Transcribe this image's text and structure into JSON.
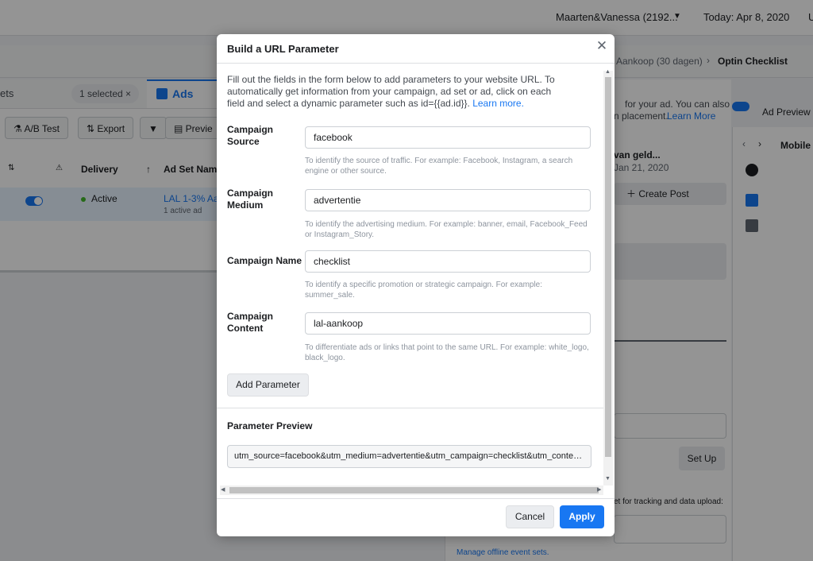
{
  "background": {
    "account": "Maarten&Vanessa (2192...",
    "date": "Today: Apr 8, 2020",
    "user_initial": "U",
    "breadcrumb": {
      "item1": "Aankoop (30 dagen)",
      "item2": "Optin Checklist"
    },
    "tabs": {
      "ad_sets_partial": "ets",
      "selected_pill": "1 selected",
      "ads": "Ads"
    },
    "toolbar": {
      "ab_test": "A/B Test",
      "export": "Export",
      "preview": "Previe"
    },
    "table": {
      "headers": {
        "delivery": "Delivery",
        "ad_set_name": "Ad Set Name"
      },
      "row": {
        "status": "Active",
        "name": "LAL 1-3% Aan",
        "sub": "1 active ad"
      }
    },
    "right_panel": {
      "text1": "for your ad. You can also",
      "text2": "n placement.",
      "learn_more": "Learn More",
      "ad_preview": "Ad Preview",
      "post_title": "van geld...",
      "post_date": "Jan 21, 2020",
      "create_post": "Create Post",
      "setup": "Set Up",
      "tracking": "et for tracking and data upload:",
      "manage": "Manage offline event sets.",
      "mobile": "Mobile"
    }
  },
  "modal": {
    "title": "Build a URL Parameter",
    "intro": "Fill out the fields in the form below to add parameters to your website URL. To automatically get information from your campaign, ad set or ad, click on each field and select a dynamic parameter such as id={{ad.id}}.",
    "learn_more": "Learn more.",
    "fields": [
      {
        "label": "Campaign Source",
        "value": "facebook",
        "help": "To identify the source of traffic. For example: Facebook, Instagram, a search engine or other source."
      },
      {
        "label": "Campaign Medium",
        "value": "advertentie",
        "help": "To identify the advertising medium. For example: banner, email, Facebook_Feed or Instagram_Story."
      },
      {
        "label": "Campaign Name",
        "value": "checklist",
        "help": "To identify a specific promotion or strategic campaign. For example: summer_sale."
      },
      {
        "label": "Campaign Content",
        "value": "lal-aankoop",
        "help": "To differentiate ads or links that point to the same URL. For example: white_logo, black_logo."
      }
    ],
    "add_parameter": "Add Parameter",
    "preview_label": "Parameter Preview",
    "preview_value": "utm_source=facebook&utm_medium=advertentie&utm_campaign=checklist&utm_content=...",
    "cancel": "Cancel",
    "apply": "Apply"
  }
}
